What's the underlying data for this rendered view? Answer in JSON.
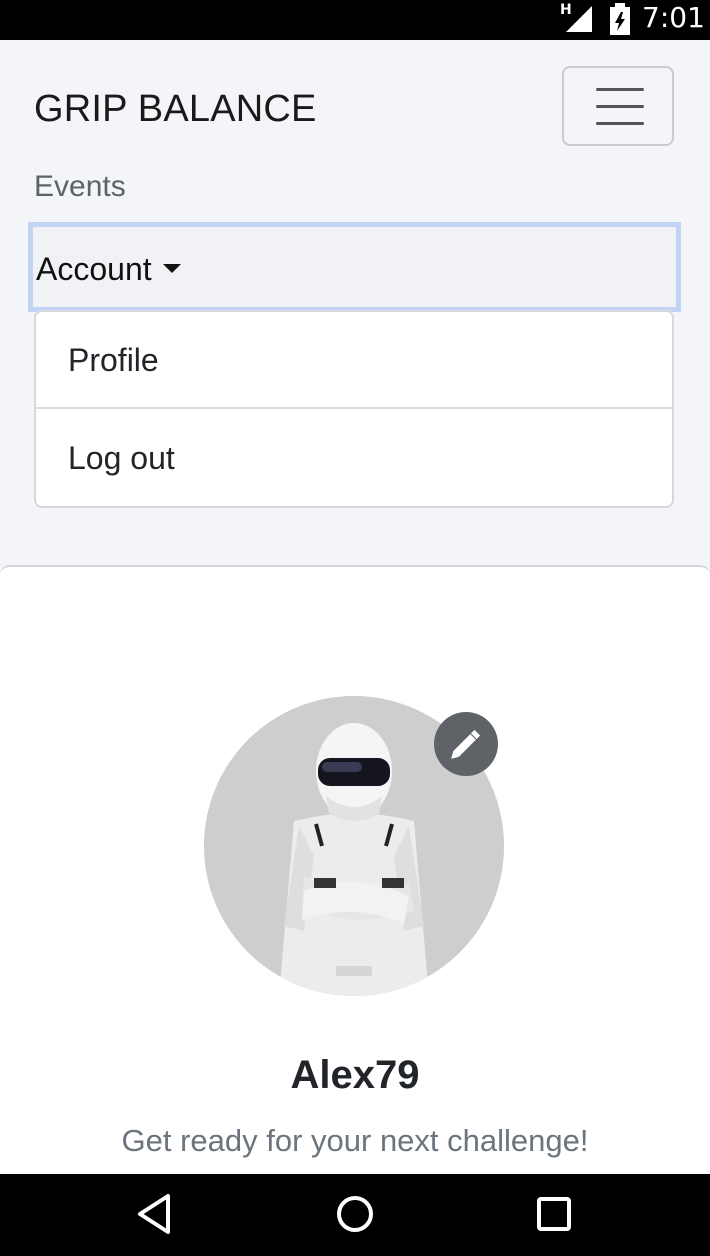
{
  "status_bar": {
    "signal_label": "H",
    "time": "7:01"
  },
  "navbar": {
    "brand": "GRIP BALANCE",
    "events_link": "Events",
    "account_label": "Account"
  },
  "dropdown": {
    "items": [
      {
        "label": "Profile"
      },
      {
        "label": "Log out"
      }
    ]
  },
  "profile": {
    "username": "Alex79",
    "tagline": "Get ready for your next challenge!"
  },
  "icons": {
    "menu": "hamburger-icon",
    "edit": "pencil-icon",
    "back": "back-triangle-icon",
    "home": "home-circle-icon",
    "recents": "recents-square-icon"
  },
  "colors": {
    "focus_outline": "#c2d4f6",
    "edit_button": "#5f6368",
    "background": "#f4f5f8"
  }
}
